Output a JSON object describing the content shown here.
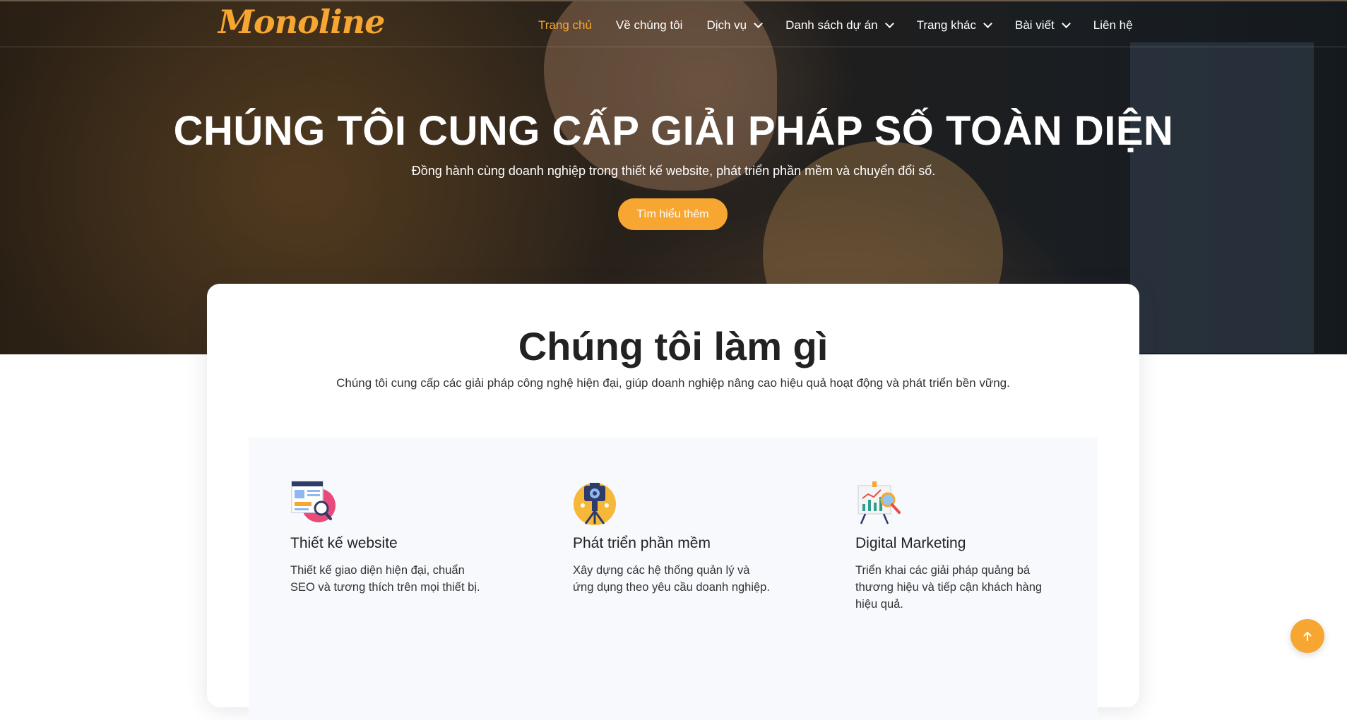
{
  "brand": {
    "logo_text": "Monoline",
    "accent_color": "#f7a631"
  },
  "nav": {
    "items": [
      {
        "label": "Trang chủ",
        "active": true,
        "has_dropdown": false
      },
      {
        "label": "Về chúng tôi",
        "active": false,
        "has_dropdown": false
      },
      {
        "label": "Dịch vụ",
        "active": false,
        "has_dropdown": true
      },
      {
        "label": "Danh sách dự án",
        "active": false,
        "has_dropdown": true
      },
      {
        "label": "Trang khác",
        "active": false,
        "has_dropdown": true
      },
      {
        "label": "Bài viết",
        "active": false,
        "has_dropdown": true
      },
      {
        "label": "Liên hệ",
        "active": false,
        "has_dropdown": false
      }
    ]
  },
  "hero": {
    "title": "CHÚNG TÔI CUNG CẤP GIẢI PHÁP SỐ TOÀN DIỆN",
    "subtitle": "Đồng hành cùng doanh nghiệp trong thiết kế website, phát triển phần mềm và chuyển đổi số.",
    "cta_label": "Tìm hiểu thêm"
  },
  "services_section": {
    "title": "Chúng tôi làm gì",
    "subtitle": "Chúng tôi cung cấp các giải pháp công nghệ hiện đại, giúp doanh nghiệp nâng cao hiệu quả hoạt động và phát triển bền vững.",
    "items": [
      {
        "icon": "web-design-icon",
        "title": "Thiết kế website",
        "description": "Thiết kế giao diện hiện đại, chuẩn SEO và tương thích trên mọi thiết bị."
      },
      {
        "icon": "software-dev-icon",
        "title": "Phát triển phần mềm",
        "description": "Xây dựng các hệ thống quản lý và ứng dụng theo yêu cầu doanh nghiệp."
      },
      {
        "icon": "marketing-chart-icon",
        "title": "Digital Marketing",
        "description": "Triển khai các giải pháp quảng bá thương hiệu và tiếp cận khách hàng hiệu quả."
      }
    ]
  },
  "back_to_top": {
    "icon": "arrow-up-icon"
  }
}
